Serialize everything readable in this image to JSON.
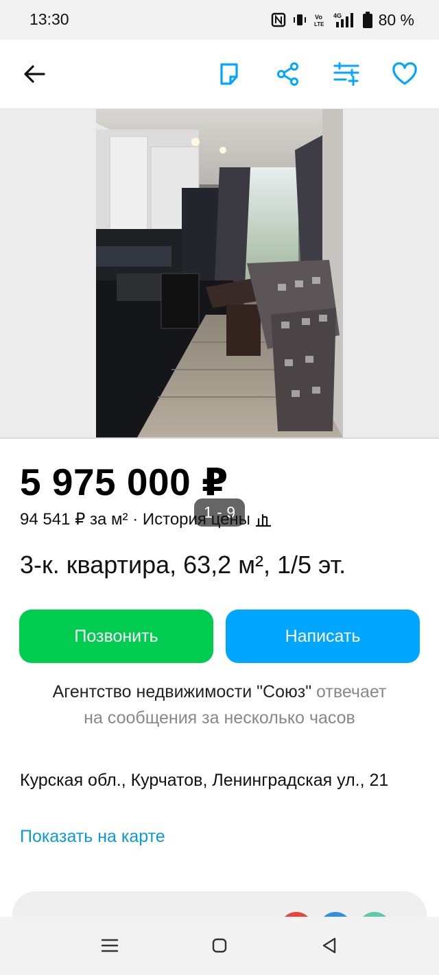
{
  "status_bar": {
    "time": "13:30",
    "battery": "80 %"
  },
  "header": {
    "icons": [
      "back-arrow-icon",
      "note-icon",
      "share-icon",
      "compare-list-icon",
      "favorite-heart-icon"
    ],
    "accent_color": "#00a6ff"
  },
  "gallery": {
    "counter": "1 - 9"
  },
  "listing": {
    "price": "5 975 000 ₽",
    "price_per_m2": "94 541 ₽ за м² · История цены",
    "title": "3-к. квартира, 63,2 м², 1/5 эт."
  },
  "actions": {
    "call_label": "Позвонить",
    "write_label": "Написать",
    "call_color": "#00cc4f",
    "write_color": "#00a6ff"
  },
  "seller": {
    "name": "Агентство недвижимости \"Союз\"",
    "response_part1": "отвечает",
    "response_part2": "на сообщения за несколько часов"
  },
  "location": {
    "address": "Курская обл., Курчатов, Ленинградская ул., 21",
    "map_link": "Показать на карте"
  },
  "nav": {
    "icons": [
      "recent-apps-icon",
      "home-icon",
      "back-icon"
    ]
  }
}
